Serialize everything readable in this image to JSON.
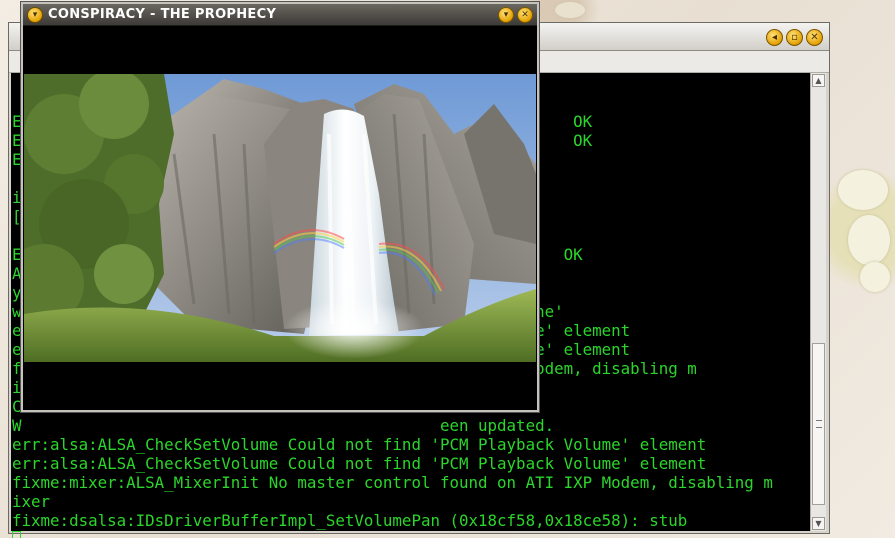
{
  "game_window": {
    "title": "CONSPIRACY - THE PROPHECY",
    "buttons": {
      "menu": "▾",
      "minimize": "▾",
      "close": "✕"
    }
  },
  "terminal_window": {
    "buttons": {
      "minimize": "◂",
      "maximize": "▫",
      "close": "✕"
    },
    "lines": [
      "",
      "E                                                          OK",
      "E                                                          OK",
      "E                                                   OK",
      "",
      "i",
      "[",
      "",
      "E                                                         OK",
      "A",
      "y",
      "w                                            esheng/.wine'",
      "e                                            back Volume' element",
      "e                                            back Volume' element",
      "f                                             ATI IXP Modem, disabling m",
      "i",
      "C                                            ed.",
      "W                                            een updated.",
      "err:alsa:ALSA_CheckSetVolume Could not find 'PCM Playback Volume' element",
      "err:alsa:ALSA_CheckSetVolume Could not find 'PCM Playback Volume' element",
      "fixme:mixer:ALSA_MixerInit No master control found on ATI IXP Modem, disabling m",
      "ixer",
      "fixme:dsalsa:IDsDriverBufferImpl_SetVolumePan (0x18cf58,0x18ce58): stub"
    ]
  },
  "scrollbar": {
    "up_arrow": "▲",
    "down_arrow": "▼"
  },
  "colors": {
    "terminal_text": "#2bd62b",
    "terminal_bg": "#000000",
    "titlebar_dark": "#3d3b37",
    "button_gold": "#e3a000"
  },
  "icons": {
    "game_menu": "chevron-down-icon",
    "game_minimize": "minimize-icon",
    "game_close": "close-icon",
    "terminal_minimize": "minimize-icon",
    "terminal_maximize": "maximize-icon",
    "terminal_close": "close-icon"
  }
}
